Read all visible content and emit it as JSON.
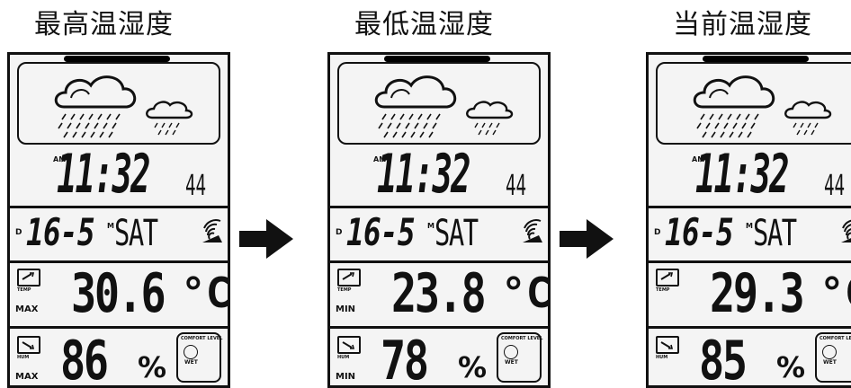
{
  "panels": [
    {
      "title": "最高温湿度",
      "ampm": "AM",
      "time": "11:32",
      "seconds": "44",
      "day_label": "D",
      "date": "16-5",
      "month_label": "M",
      "weekday": "SAT",
      "temp_label": "TEMP",
      "temperature": "30.6",
      "temp_unit": "°C",
      "temp_tag": "MAX",
      "humidity_label": "HUM",
      "humidity": "86",
      "humidity_unit": "%",
      "humidity_tag": "MAX",
      "comfort_label": "COMFORT LEVEL",
      "comfort_state": "WET"
    },
    {
      "title": "最低温湿度",
      "ampm": "AM",
      "time": "11:32",
      "seconds": "44",
      "day_label": "D",
      "date": "16-5",
      "month_label": "M",
      "weekday": "SAT",
      "temp_label": "TEMP",
      "temperature": "23.8",
      "temp_unit": "°C",
      "temp_tag": "MIN",
      "humidity_label": "HUM",
      "humidity": "78",
      "humidity_unit": "%",
      "humidity_tag": "MIN",
      "comfort_label": "COMFORT LEVEL",
      "comfort_state": "WET"
    },
    {
      "title": "当前温湿度",
      "ampm": "AM",
      "time": "11:32",
      "seconds": "44",
      "day_label": "D",
      "date": "16-5",
      "month_label": "M",
      "weekday": "SAT",
      "temp_label": "TEMP",
      "temperature": "29.3",
      "temp_unit": "°C",
      "temp_tag": "",
      "humidity_label": "HUM",
      "humidity": "85",
      "humidity_unit": "%",
      "humidity_tag": "",
      "comfort_label": "COMFORT LEVEL",
      "comfort_state": "WET"
    }
  ],
  "arrows": [
    "arrow-right-icon",
    "arrow-right-icon"
  ]
}
